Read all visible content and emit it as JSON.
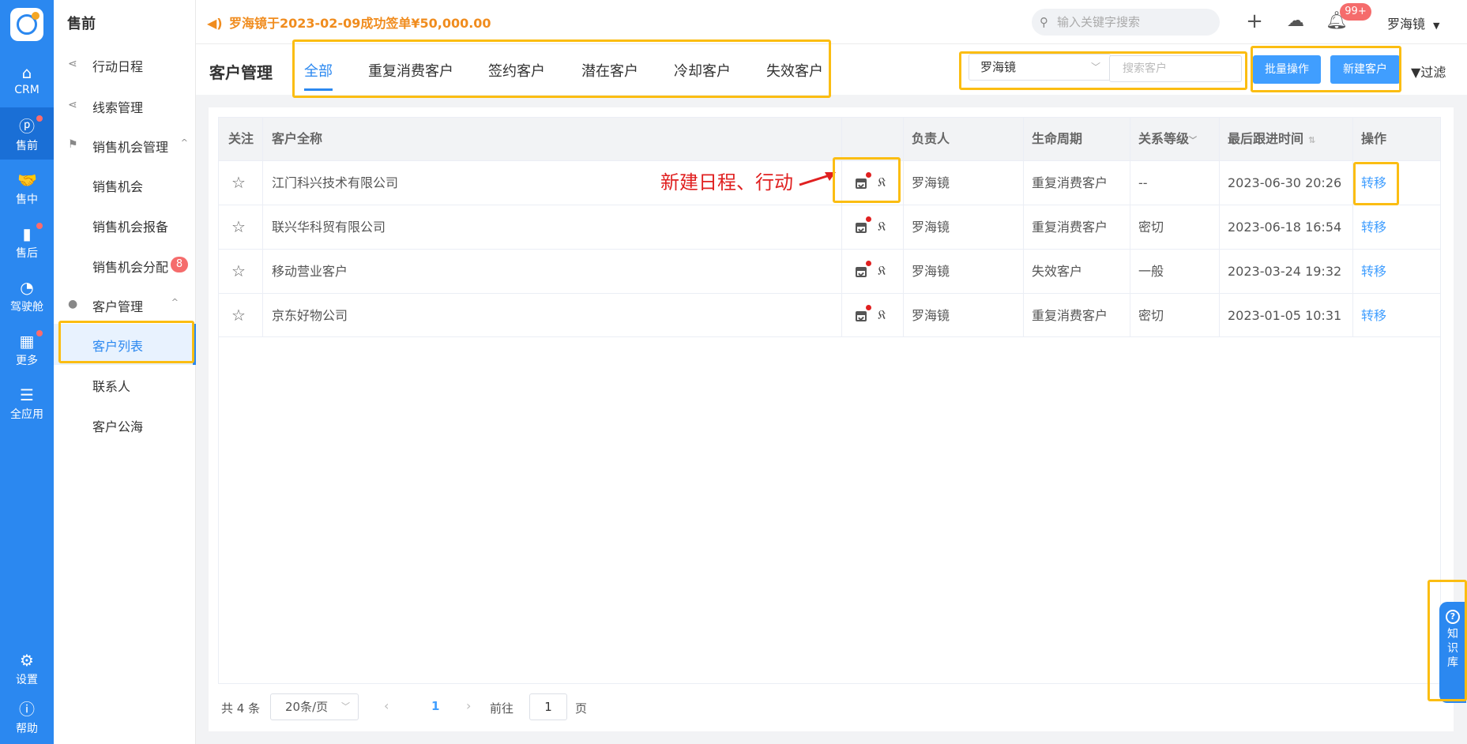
{
  "rail": {
    "items": [
      {
        "label": "CRM",
        "icon": "home-icon"
      },
      {
        "label": "售前",
        "icon": "pinterest-icon"
      },
      {
        "label": "售中",
        "icon": "handshake-icon"
      },
      {
        "label": "售后",
        "icon": "receipt-icon"
      },
      {
        "label": "驾驶舱",
        "icon": "dashboard-icon"
      },
      {
        "label": "更多",
        "icon": "grid-icon"
      },
      {
        "label": "全应用",
        "icon": "menu-icon"
      },
      {
        "label": "设置",
        "icon": "gear-icon"
      },
      {
        "label": "帮助",
        "icon": "help-icon"
      }
    ]
  },
  "sidebar": {
    "title": "售前",
    "items": [
      {
        "label": "行动日程"
      },
      {
        "label": "线索管理"
      },
      {
        "label": "销售机会管理"
      },
      {
        "label": "销售机会"
      },
      {
        "label": "销售机会报备"
      },
      {
        "label": "销售机会分配",
        "badge": "8"
      },
      {
        "label": "客户管理"
      },
      {
        "label": "客户列表"
      },
      {
        "label": "联系人"
      },
      {
        "label": "客户公海"
      }
    ]
  },
  "topbar": {
    "notice": "罗海镜于2023-02-09成功签单¥50,000.00",
    "search_placeholder": "输入关键字搜索",
    "notification_badge": "99+",
    "user_name": "罗海镜"
  },
  "page": {
    "title": "客户管理",
    "tabs": [
      "全部",
      "重复消费客户",
      "签约客户",
      "潜在客户",
      "冷却客户",
      "失效客户"
    ],
    "owner_select": "罗海镜",
    "search_placeholder": "搜索客户",
    "batch_button": "批量操作",
    "new_button": "新建客户",
    "filter_label": "过滤"
  },
  "table": {
    "headers": [
      "关注",
      "客户全称",
      "负责人",
      "生命周期",
      "关系等级",
      "最后跟进时间",
      "操作"
    ],
    "rows": [
      {
        "name": "江门科兴技术有限公司",
        "owner": "罗海镜",
        "lifecycle": "重复消费客户",
        "level": "--",
        "last_follow": "2023-06-30 20:26",
        "action": "转移"
      },
      {
        "name": "联兴华科贸有限公司",
        "owner": "罗海镜",
        "lifecycle": "重复消费客户",
        "level": "密切",
        "last_follow": "2023-06-18 16:54",
        "action": "转移"
      },
      {
        "name": "移动营业客户",
        "owner": "罗海镜",
        "lifecycle": "失效客户",
        "level": "一般",
        "last_follow": "2023-03-24 19:32",
        "action": "转移"
      },
      {
        "name": "京东好物公司",
        "owner": "罗海镜",
        "lifecycle": "重复消费客户",
        "level": "密切",
        "last_follow": "2023-01-05 10:31",
        "action": "转移"
      }
    ]
  },
  "annotation": "新建日程、行动",
  "pager": {
    "total": "共 4 条",
    "page_size": "20条/页",
    "current": "1",
    "goto_label": "前往",
    "goto_value": "1",
    "unit": "页"
  },
  "knowledge": {
    "chars": [
      "知",
      "识",
      "库"
    ]
  },
  "colors": {
    "primary": "#2b88f0",
    "highlight": "#fbbd12",
    "annotation": "#e02020"
  }
}
